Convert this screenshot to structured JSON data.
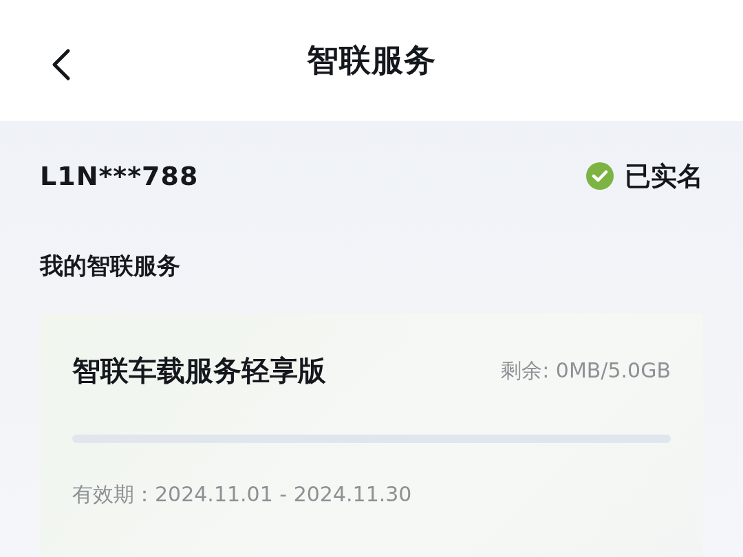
{
  "header": {
    "title": "智联服务"
  },
  "account": {
    "vin": "L1N***788",
    "verified": true,
    "verified_label": "已实名"
  },
  "section": {
    "title": "我的智联服务"
  },
  "plan": {
    "name": "智联车载服务轻享版",
    "remaining": "剩余: 0MB/5.0GB",
    "level": 0,
    "validity": "有效期：2024.11.01 - 2024.11.30"
  }
}
